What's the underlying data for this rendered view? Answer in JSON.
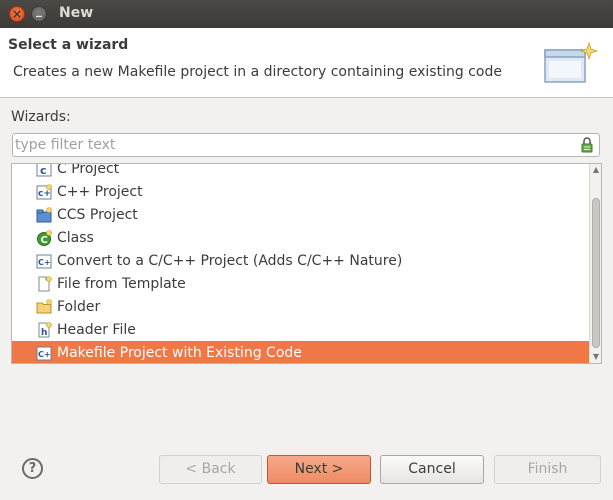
{
  "window": {
    "title": "New"
  },
  "banner": {
    "title": "Select a wizard",
    "description": "Creates a new Makefile project in a directory containing existing code",
    "art_icon": "wizard-banner-icon"
  },
  "wizards": {
    "label": "Wizards:",
    "filter_placeholder": "type filter text",
    "items": [
      {
        "label": "C Project",
        "icon": "c-project-icon"
      },
      {
        "label": "C++ Project",
        "icon": "cpp-project-icon"
      },
      {
        "label": "CCS Project",
        "icon": "ccs-project-icon"
      },
      {
        "label": "Class",
        "icon": "class-icon"
      },
      {
        "label": "Convert to a C/C++ Project (Adds C/C++ Nature)",
        "icon": "convert-icon"
      },
      {
        "label": "File from Template",
        "icon": "file-icon"
      },
      {
        "label": "Folder",
        "icon": "folder-icon"
      },
      {
        "label": "Header File",
        "icon": "header-file-icon"
      },
      {
        "label": "Makefile Project with Existing Code",
        "icon": "makefile-project-icon",
        "selected": true
      }
    ]
  },
  "buttons": {
    "help": "?",
    "back": "< Back",
    "next": "Next >",
    "cancel": "Cancel",
    "finish": "Finish"
  },
  "colors": {
    "selection": "#f07746",
    "titlebar": "#3c3b37",
    "close_button": "#df4a16"
  }
}
